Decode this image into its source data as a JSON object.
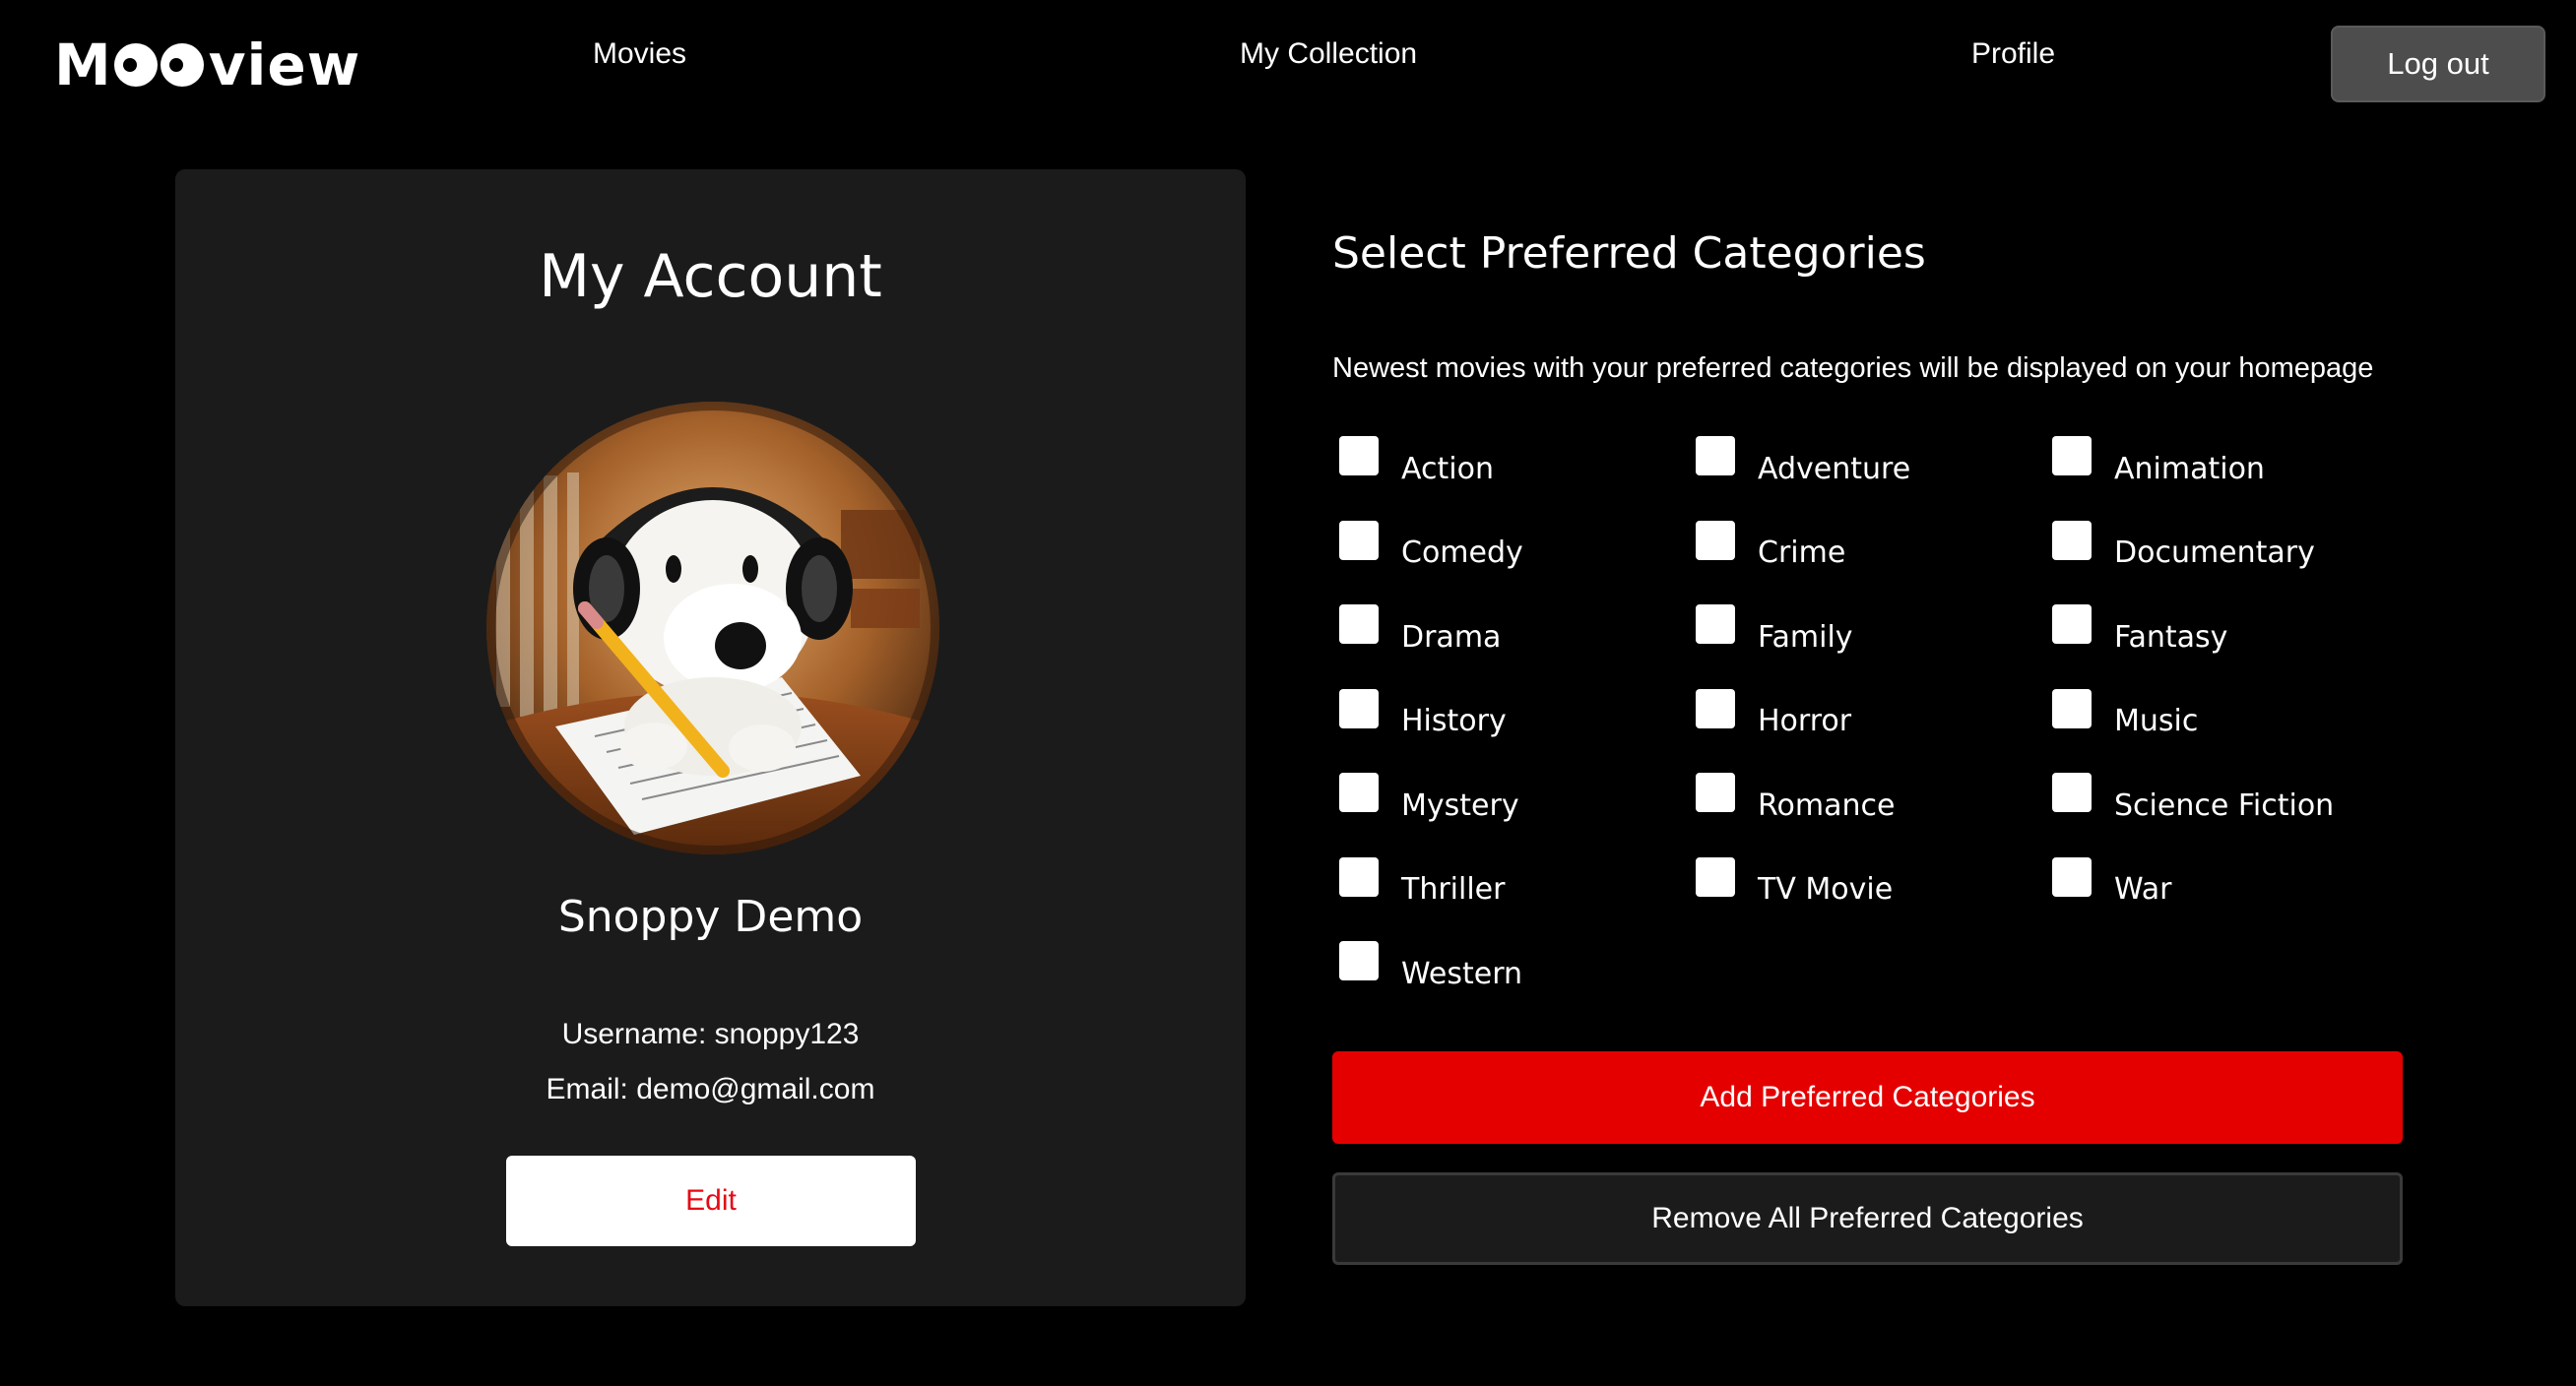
{
  "nav": {
    "logo": {
      "prefix": "M",
      "suffix": "view",
      "icon": "two-eyes-logo-mark"
    },
    "links": {
      "movies": "Movies",
      "collection": "My Collection",
      "profile": "Profile"
    },
    "logout_label": "Log out"
  },
  "account": {
    "title": "My Account",
    "avatar_icon": "profile-photo-snoopy-with-headphones",
    "display_name": "Snoppy Demo",
    "username_line": "Username: snoppy123",
    "email_line": "Email: demo@gmail.com",
    "edit_label": "Edit"
  },
  "categories": {
    "title": "Select Preferred Categories",
    "subtitle": "Newest movies with your preferred categories will be displayed on your homepage",
    "items": [
      "Action",
      "Adventure",
      "Animation",
      "Comedy",
      "Crime",
      "Documentary",
      "Drama",
      "Family",
      "Fantasy",
      "History",
      "Horror",
      "Music",
      "Mystery",
      "Romance",
      "Science Fiction",
      "Thriller",
      "TV Movie",
      "War",
      "Western"
    ],
    "checked": [],
    "add_label": "Add Preferred Categories",
    "remove_label": "Remove All Preferred Categories"
  },
  "colors": {
    "background": "#000000",
    "card": "#1b1b1b",
    "accent_red": "#e50000",
    "logout_gray": "#4d4d4d"
  }
}
